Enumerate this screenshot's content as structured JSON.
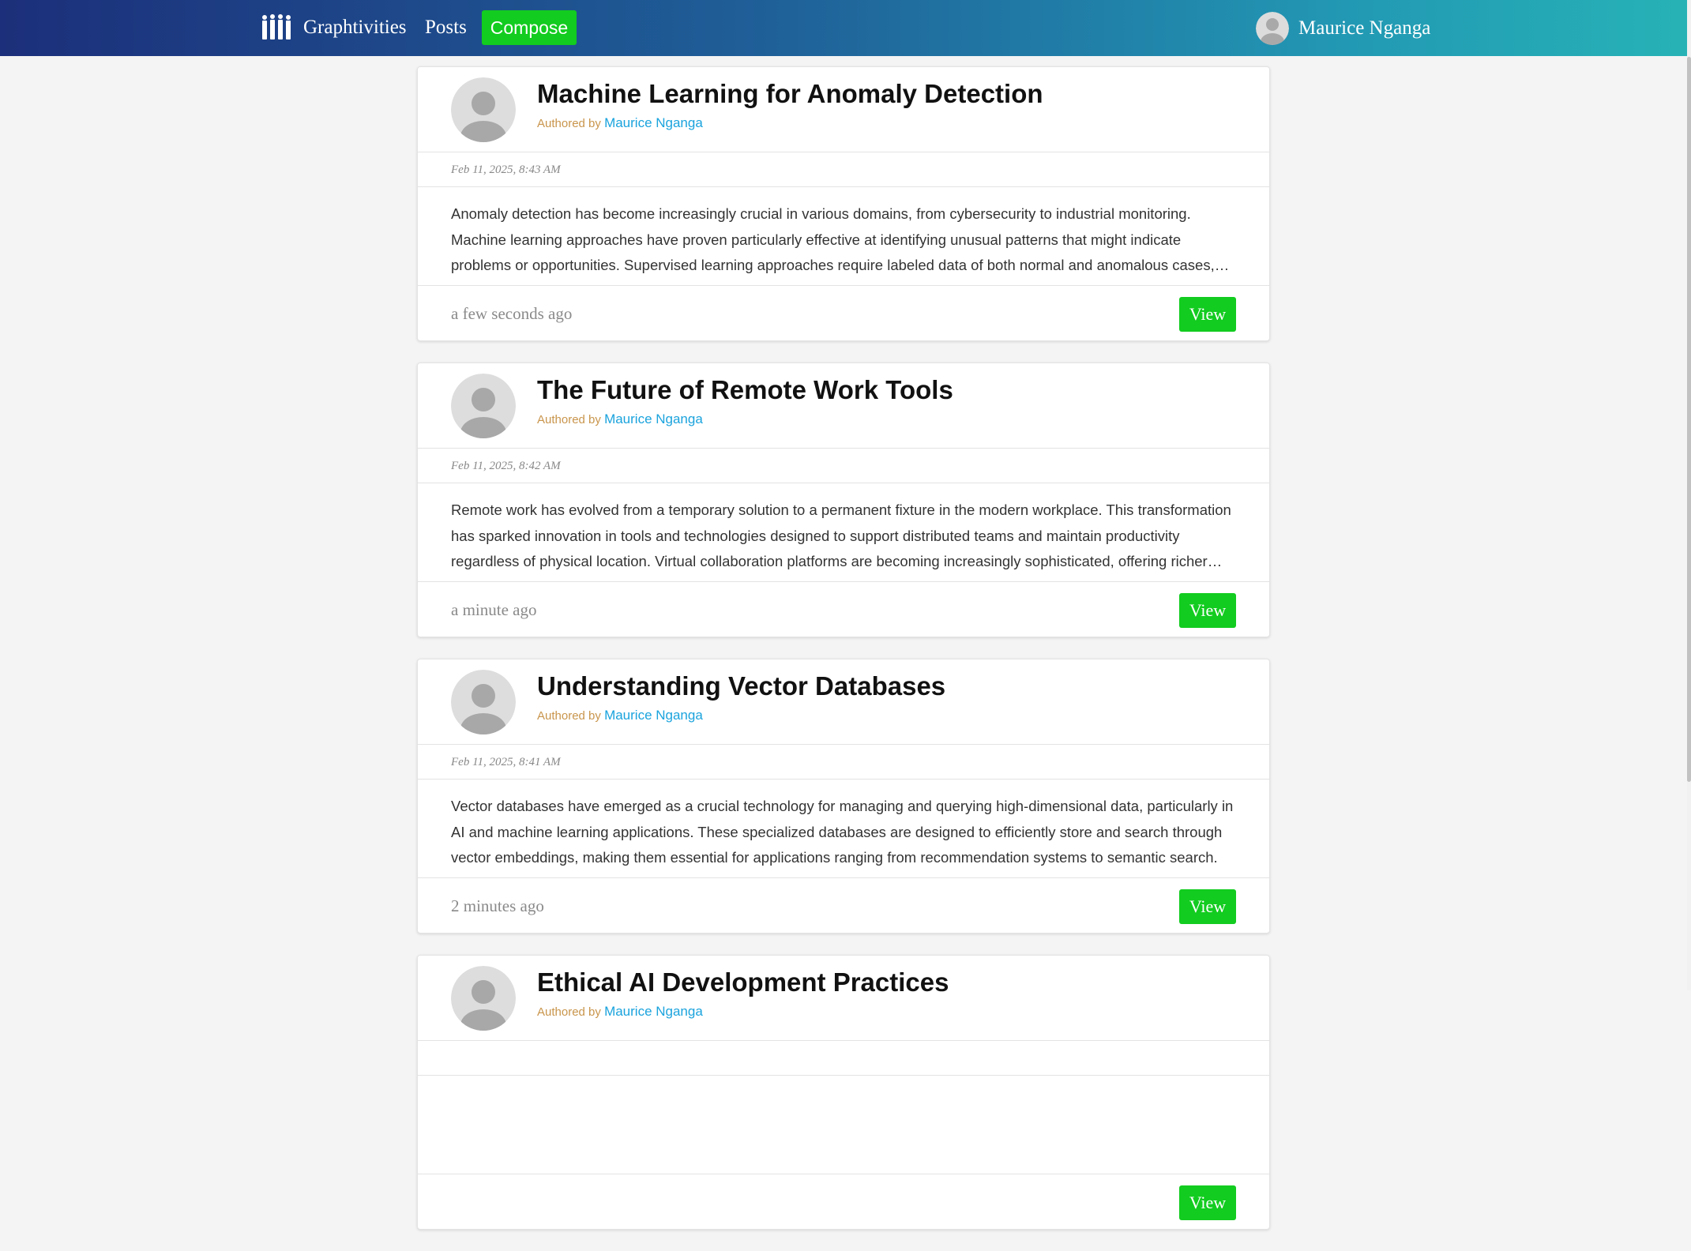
{
  "nav": {
    "brand": "Graphtivities",
    "posts_label": "Posts",
    "compose_label": "Compose",
    "user_name": "Maurice Nganga",
    "logo_icon": "bar-chart-people-icon",
    "avatar_icon": "user-avatar-icon"
  },
  "colors": {
    "nav_gradient_start": "#1c2f7a",
    "nav_gradient_end": "#27b3b6",
    "accent_green": "#12cc1f",
    "author_link": "#1aa3dd",
    "byline": "#c9954c"
  },
  "posts": [
    {
      "title": "Machine Learning for Anomaly Detection",
      "byline_prefix": "Authored by",
      "author": "Maurice Nganga",
      "date": "Feb 11, 2025, 8:43 AM",
      "excerpt": "Anomaly detection has become increasingly crucial in various domains, from cybersecurity to industrial monitoring. Machine learning approaches have proven particularly effective at identifying unusual patterns that might indicate problems or opportunities. Supervised learning approaches require labeled data of both normal and anomalous cases, making them effective when such data is available.",
      "ago": "a few seconds ago",
      "view_label": "View"
    },
    {
      "title": "The Future of Remote Work Tools",
      "byline_prefix": "Authored by",
      "author": "Maurice Nganga",
      "date": "Feb 11, 2025, 8:42 AM",
      "excerpt": "Remote work has evolved from a temporary solution to a permanent fixture in the modern workplace. This transformation has sparked innovation in tools and technologies designed to support distributed teams and maintain productivity regardless of physical location. Virtual collaboration platforms are becoming increasingly sophisticated, offering richer experiences.",
      "ago": "a minute ago",
      "view_label": "View"
    },
    {
      "title": "Understanding Vector Databases",
      "byline_prefix": "Authored by",
      "author": "Maurice Nganga",
      "date": "Feb 11, 2025, 8:41 AM",
      "excerpt": "Vector databases have emerged as a crucial technology for managing and querying high-dimensional data, particularly in AI and machine learning applications. These specialized databases are designed to efficiently store and search through vector embeddings, making them essential for applications ranging from recommendation systems to semantic search.",
      "ago": "2 minutes ago",
      "view_label": "View"
    },
    {
      "title": "Ethical AI Development Practices",
      "byline_prefix": "Authored by",
      "author": "Maurice Nganga",
      "date": "",
      "excerpt": "",
      "ago": "",
      "view_label": "View"
    }
  ]
}
